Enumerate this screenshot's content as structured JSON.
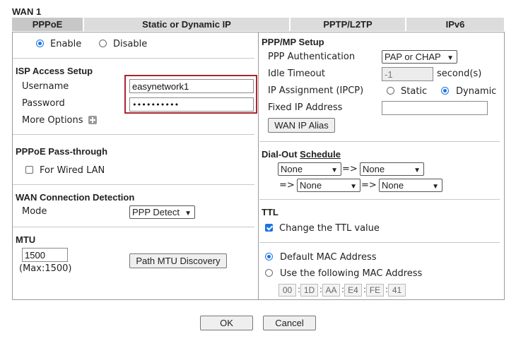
{
  "page": {
    "title": "WAN 1"
  },
  "tabs": [
    {
      "label": "PPPoE"
    },
    {
      "label": "Static or Dynamic IP"
    },
    {
      "label": "PPTP/L2TP"
    },
    {
      "label": "IPv6"
    }
  ],
  "left": {
    "enable": {
      "enable_label": "Enable",
      "disable_label": "Disable",
      "selected": "Enable"
    },
    "isp": {
      "heading": "ISP Access Setup",
      "username_label": "Username",
      "username_value": "easynetwork1",
      "password_label": "Password",
      "password_value": "••••••••••",
      "more_options_label": "More Options"
    },
    "passthrough": {
      "heading": "PPPoE Pass-through",
      "wired_label": "For Wired LAN",
      "wired_checked": false
    },
    "detection": {
      "heading": "WAN Connection Detection",
      "mode_label": "Mode",
      "mode_value": "PPP Detect"
    },
    "mtu": {
      "heading": "MTU",
      "value": "1500",
      "max_text": "(Max:1500)",
      "path_button": "Path MTU Discovery"
    }
  },
  "right": {
    "ppp": {
      "heading": "PPP/MP Setup",
      "auth_label": "PPP Authentication",
      "auth_value": "PAP or CHAP",
      "idle_label": "Idle Timeout",
      "idle_value": "-1",
      "idle_unit": "second(s)",
      "ipcp_label": "IP Assignment (IPCP)",
      "ipcp_static": "Static",
      "ipcp_dynamic": "Dynamic",
      "ipcp_selected": "Dynamic",
      "fixed_ip_label": "Fixed IP Address",
      "fixed_ip_value": "",
      "wan_alias_button": "WAN IP Alias"
    },
    "dialout": {
      "heading_prefix": "Dial-Out ",
      "heading_link": "Schedule",
      "slots": [
        "None",
        "None",
        "None",
        "None"
      ],
      "arrow": "=>"
    },
    "ttl": {
      "heading": "TTL",
      "change_label": "Change the TTL value",
      "checked": true
    },
    "mac": {
      "default_label": "Default MAC Address",
      "custom_label": "Use the following MAC Address",
      "selected": "default",
      "octets": [
        "00",
        "1D",
        "AA",
        "E4",
        "FE",
        "41"
      ]
    }
  },
  "footer": {
    "ok_label": "OK",
    "cancel_label": "Cancel"
  },
  "colors": {
    "highlight_border": "#a8262f",
    "accent": "#1a73e8"
  }
}
